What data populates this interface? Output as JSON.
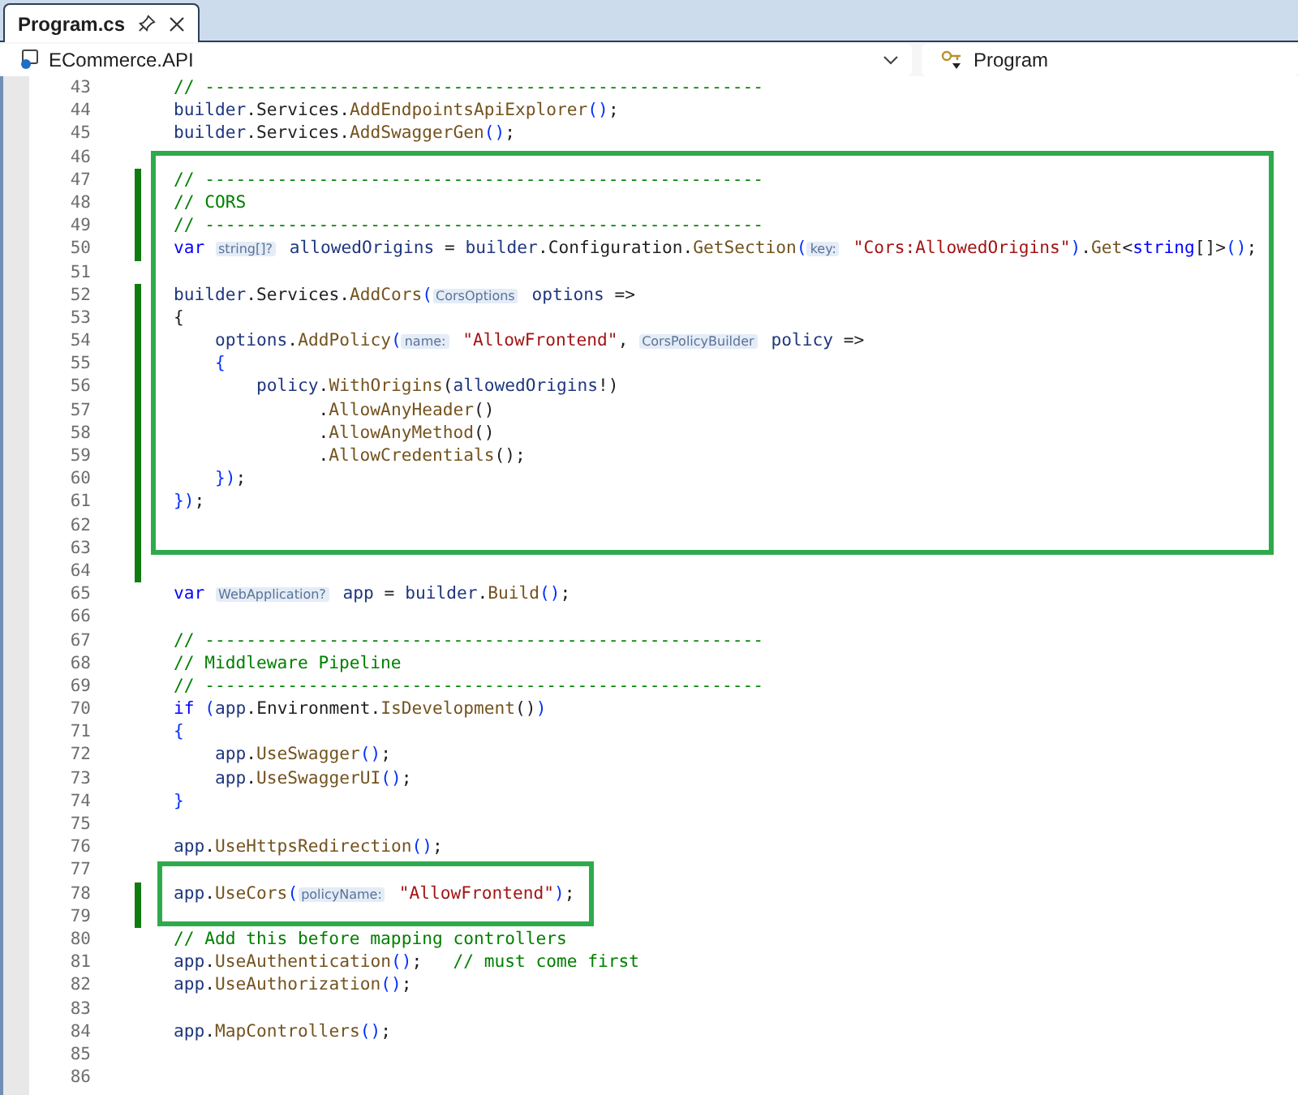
{
  "tabs": [
    {
      "label": "Program.cs",
      "selected": true
    }
  ],
  "navigation": {
    "project": "ECommerce.API",
    "member": "Program"
  },
  "code_blocks": [
    {
      "boxed": false,
      "lines": [
        {
          "number": "43",
          "changed": false,
          "tokens": [
            {
              "kind": "comment",
              "text": "// ------------------------------------------------------"
            }
          ]
        },
        {
          "number": "44",
          "changed": false,
          "tokens": [
            {
              "kind": "ident",
              "text": "builder"
            },
            {
              "kind": "punct",
              "text": "."
            },
            {
              "kind": "prop",
              "text": "Services"
            },
            {
              "kind": "punct",
              "text": "."
            },
            {
              "kind": "method",
              "text": "AddEndpointsApiExplorer"
            },
            {
              "kind": "paren",
              "text": "()"
            },
            {
              "kind": "punct",
              "text": ";"
            }
          ]
        },
        {
          "number": "45",
          "changed": false,
          "tokens": [
            {
              "kind": "ident",
              "text": "builder"
            },
            {
              "kind": "punct",
              "text": "."
            },
            {
              "kind": "prop",
              "text": "Services"
            },
            {
              "kind": "punct",
              "text": "."
            },
            {
              "kind": "method",
              "text": "AddSwaggerGen"
            },
            {
              "kind": "paren",
              "text": "()"
            },
            {
              "kind": "punct",
              "text": ";"
            }
          ]
        },
        {
          "number": "46",
          "changed": false
        }
      ]
    },
    {
      "boxed": true,
      "lines": [
        {
          "number": "47",
          "changed": true,
          "tokens": [
            {
              "kind": "comment",
              "text": "// ------------------------------------------------------"
            }
          ]
        },
        {
          "number": "48",
          "changed": true,
          "tokens": [
            {
              "kind": "comment",
              "text": "// CORS"
            }
          ]
        },
        {
          "number": "49",
          "changed": true,
          "tokens": [
            {
              "kind": "comment",
              "text": "// ------------------------------------------------------"
            }
          ]
        },
        {
          "number": "50",
          "changed": true,
          "tokens": [
            {
              "kind": "keyword",
              "text": "var "
            },
            {
              "kind": "hint",
              "text": "string[]?"
            },
            {
              "kind": "ident",
              "text": " allowedOrigins"
            },
            {
              "kind": "punct",
              "text": " = "
            },
            {
              "kind": "ident",
              "text": "builder"
            },
            {
              "kind": "punct",
              "text": "."
            },
            {
              "kind": "prop",
              "text": "Configuration"
            },
            {
              "kind": "punct",
              "text": "."
            },
            {
              "kind": "method",
              "text": "GetSection"
            },
            {
              "kind": "paren",
              "text": "("
            },
            {
              "kind": "hint",
              "text": "key:"
            },
            {
              "kind": "string",
              "text": " \"Cors:AllowedOrigins\""
            },
            {
              "kind": "paren",
              "text": ")"
            },
            {
              "kind": "punct",
              "text": "."
            },
            {
              "kind": "method",
              "text": "Get"
            },
            {
              "kind": "punct",
              "text": "<"
            },
            {
              "kind": "keyword",
              "text": "string"
            },
            {
              "kind": "punct",
              "text": "[]>"
            },
            {
              "kind": "paren",
              "text": "()"
            },
            {
              "kind": "punct",
              "text": ";"
            }
          ]
        },
        {
          "number": "51",
          "changed": false
        },
        {
          "number": "52",
          "changed": true,
          "tokens": [
            {
              "kind": "ident",
              "text": "builder"
            },
            {
              "kind": "punct",
              "text": "."
            },
            {
              "kind": "prop",
              "text": "Services"
            },
            {
              "kind": "punct",
              "text": "."
            },
            {
              "kind": "method",
              "text": "AddCors"
            },
            {
              "kind": "paren",
              "text": "("
            },
            {
              "kind": "hint",
              "text": "CorsOptions"
            },
            {
              "kind": "ident",
              "text": " options"
            },
            {
              "kind": "punct",
              "text": " =>"
            }
          ]
        },
        {
          "number": "53",
          "changed": true,
          "tokens": [
            {
              "kind": "punct",
              "text": "{"
            }
          ]
        },
        {
          "number": "54",
          "changed": true,
          "tokens": [
            {
              "kind": "ident",
              "text": "    options"
            },
            {
              "kind": "punct",
              "text": "."
            },
            {
              "kind": "method",
              "text": "AddPolicy"
            },
            {
              "kind": "paren",
              "text": "("
            },
            {
              "kind": "hint",
              "text": "name:"
            },
            {
              "kind": "string",
              "text": " \"AllowFrontend\""
            },
            {
              "kind": "punct",
              "text": ", "
            },
            {
              "kind": "hint",
              "text": "CorsPolicyBuilder"
            },
            {
              "kind": "ident",
              "text": " policy"
            },
            {
              "kind": "punct",
              "text": " =>"
            }
          ]
        },
        {
          "number": "55",
          "changed": true,
          "tokens": [
            {
              "kind": "paren",
              "text": "    {"
            }
          ]
        },
        {
          "number": "56",
          "changed": true,
          "tokens": [
            {
              "kind": "ident",
              "text": "        policy"
            },
            {
              "kind": "punct",
              "text": "."
            },
            {
              "kind": "method",
              "text": "WithOrigins"
            },
            {
              "kind": "punct",
              "text": "("
            },
            {
              "kind": "ident",
              "text": "allowedOrigins"
            },
            {
              "kind": "punct",
              "text": "!)"
            }
          ]
        },
        {
          "number": "57",
          "changed": true,
          "tokens": [
            {
              "kind": "punct",
              "text": "              ."
            },
            {
              "kind": "method",
              "text": "AllowAnyHeader"
            },
            {
              "kind": "punct",
              "text": "()"
            }
          ]
        },
        {
          "number": "58",
          "changed": true,
          "tokens": [
            {
              "kind": "punct",
              "text": "              ."
            },
            {
              "kind": "method",
              "text": "AllowAnyMethod"
            },
            {
              "kind": "punct",
              "text": "()"
            }
          ]
        },
        {
          "number": "59",
          "changed": true,
          "tokens": [
            {
              "kind": "punct",
              "text": "              ."
            },
            {
              "kind": "method",
              "text": "AllowCredentials"
            },
            {
              "kind": "punct",
              "text": "();"
            }
          ]
        },
        {
          "number": "60",
          "changed": true,
          "tokens": [
            {
              "kind": "paren",
              "text": "    })"
            },
            {
              "kind": "punct",
              "text": ";"
            }
          ]
        },
        {
          "number": "61",
          "changed": true,
          "tokens": [
            {
              "kind": "paren",
              "text": "})"
            },
            {
              "kind": "punct",
              "text": ";"
            }
          ]
        },
        {
          "number": "62",
          "changed": true
        }
      ]
    },
    {
      "boxed": false,
      "lines": [
        {
          "number": "63",
          "changed": true
        },
        {
          "number": "64",
          "changed": true
        },
        {
          "number": "65",
          "changed": false,
          "tokens": [
            {
              "kind": "keyword",
              "text": "var "
            },
            {
              "kind": "hint",
              "text": "WebApplication?"
            },
            {
              "kind": "ident",
              "text": " app"
            },
            {
              "kind": "punct",
              "text": " = "
            },
            {
              "kind": "ident",
              "text": "builder"
            },
            {
              "kind": "punct",
              "text": "."
            },
            {
              "kind": "method",
              "text": "Build"
            },
            {
              "kind": "paren",
              "text": "()"
            },
            {
              "kind": "punct",
              "text": ";"
            }
          ]
        },
        {
          "number": "66",
          "changed": false
        },
        {
          "number": "67",
          "changed": false,
          "tokens": [
            {
              "kind": "comment",
              "text": "// ------------------------------------------------------"
            }
          ]
        },
        {
          "number": "68",
          "changed": false,
          "tokens": [
            {
              "kind": "comment",
              "text": "// Middleware Pipeline"
            }
          ]
        },
        {
          "number": "69",
          "changed": false,
          "tokens": [
            {
              "kind": "comment",
              "text": "// ------------------------------------------------------"
            }
          ]
        },
        {
          "number": "70",
          "changed": false,
          "tokens": [
            {
              "kind": "keyword",
              "text": "if "
            },
            {
              "kind": "paren",
              "text": "("
            },
            {
              "kind": "ident",
              "text": "app"
            },
            {
              "kind": "punct",
              "text": "."
            },
            {
              "kind": "prop",
              "text": "Environment"
            },
            {
              "kind": "punct",
              "text": "."
            },
            {
              "kind": "method",
              "text": "IsDevelopment"
            },
            {
              "kind": "punct",
              "text": "()"
            },
            {
              "kind": "paren",
              "text": ")"
            }
          ]
        },
        {
          "number": "71",
          "changed": false,
          "tokens": [
            {
              "kind": "paren",
              "text": "{"
            }
          ]
        },
        {
          "number": "72",
          "changed": false,
          "tokens": [
            {
              "kind": "ident",
              "text": "    app"
            },
            {
              "kind": "punct",
              "text": "."
            },
            {
              "kind": "method",
              "text": "UseSwagger"
            },
            {
              "kind": "paren",
              "text": "()"
            },
            {
              "kind": "punct",
              "text": ";"
            }
          ]
        },
        {
          "number": "73",
          "changed": false,
          "tokens": [
            {
              "kind": "ident",
              "text": "    app"
            },
            {
              "kind": "punct",
              "text": "."
            },
            {
              "kind": "method",
              "text": "UseSwaggerUI"
            },
            {
              "kind": "paren",
              "text": "()"
            },
            {
              "kind": "punct",
              "text": ";"
            }
          ]
        },
        {
          "number": "74",
          "changed": false,
          "tokens": [
            {
              "kind": "paren",
              "text": "}"
            }
          ]
        },
        {
          "number": "75",
          "changed": false
        },
        {
          "number": "76",
          "changed": false,
          "tokens": [
            {
              "kind": "ident",
              "text": "app"
            },
            {
              "kind": "punct",
              "text": "."
            },
            {
              "kind": "method",
              "text": "UseHttpsRedirection"
            },
            {
              "kind": "paren",
              "text": "()"
            },
            {
              "kind": "punct",
              "text": ";"
            }
          ]
        },
        {
          "number": "77",
          "changed": false
        }
      ]
    },
    {
      "boxed": true,
      "lines": [
        {
          "number": "78",
          "changed": true,
          "tokens": [
            {
              "kind": "ident",
              "text": "app"
            },
            {
              "kind": "punct",
              "text": "."
            },
            {
              "kind": "method",
              "text": "UseCors"
            },
            {
              "kind": "paren",
              "text": "("
            },
            {
              "kind": "hint",
              "text": "policyName:"
            },
            {
              "kind": "string",
              "text": " \"AllowFrontend\""
            },
            {
              "kind": "paren",
              "text": ")"
            },
            {
              "kind": "punct",
              "text": ";"
            }
          ]
        }
      ]
    },
    {
      "boxed": false,
      "lines": [
        {
          "number": "79",
          "changed": true
        },
        {
          "number": "80",
          "changed": false,
          "tokens": [
            {
              "kind": "comment",
              "text": "// Add this before mapping controllers"
            }
          ]
        },
        {
          "number": "81",
          "changed": false,
          "tokens": [
            {
              "kind": "ident",
              "text": "app"
            },
            {
              "kind": "punct",
              "text": "."
            },
            {
              "kind": "method",
              "text": "UseAuthentication"
            },
            {
              "kind": "paren",
              "text": "()"
            },
            {
              "kind": "punct",
              "text": ";   "
            },
            {
              "kind": "comment",
              "text": "// must come first"
            }
          ]
        },
        {
          "number": "82",
          "changed": false,
          "tokens": [
            {
              "kind": "ident",
              "text": "app"
            },
            {
              "kind": "punct",
              "text": "."
            },
            {
              "kind": "method",
              "text": "UseAuthorization"
            },
            {
              "kind": "paren",
              "text": "()"
            },
            {
              "kind": "punct",
              "text": ";"
            }
          ]
        },
        {
          "number": "83",
          "changed": false
        },
        {
          "number": "84",
          "changed": false,
          "tokens": [
            {
              "kind": "ident",
              "text": "app"
            },
            {
              "kind": "punct",
              "text": "."
            },
            {
              "kind": "method",
              "text": "MapControllers"
            },
            {
              "kind": "paren",
              "text": "()"
            },
            {
              "kind": "punct",
              "text": ";"
            }
          ]
        },
        {
          "number": "85",
          "changed": false
        },
        {
          "number": "86",
          "changed": false
        }
      ]
    }
  ]
}
